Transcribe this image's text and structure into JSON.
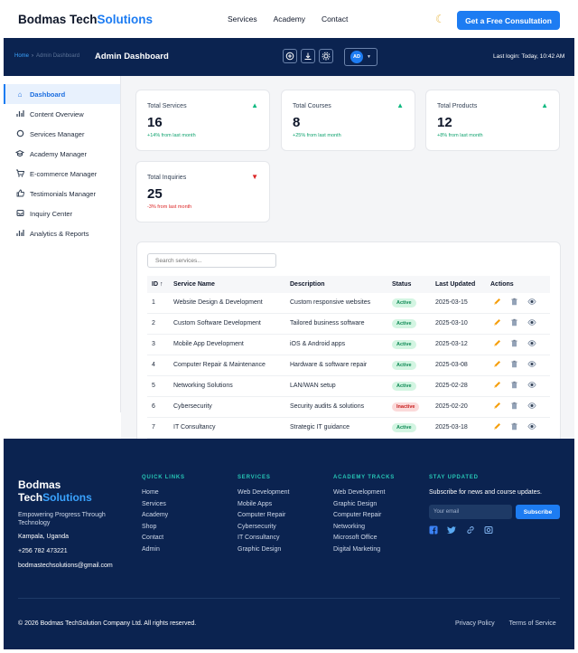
{
  "brand": {
    "name_part1": "Bodmas Tech",
    "name_part2": "Solutions"
  },
  "topnav": {
    "links": [
      "Services",
      "Academy",
      "Contact"
    ],
    "theme_icon": "moon-icon",
    "cta_label": "Get a Free Consultation"
  },
  "adminbar": {
    "breadcrumb": {
      "home": "Home",
      "separator": "›",
      "current": "Admin Dashboard"
    },
    "title": "Admin Dashboard",
    "toolbar_icons": [
      "add-circle-icon",
      "download-icon",
      "gear-icon"
    ],
    "avatar_initials": "AD",
    "last_login": "Last login: Today, 10:42 AM"
  },
  "sidebar": {
    "items": [
      {
        "label": "Dashboard",
        "icon": "home-icon",
        "active": true
      },
      {
        "label": "Content Overview",
        "icon": "bar-chart-icon"
      },
      {
        "label": "Services Manager",
        "icon": "gear-icon"
      },
      {
        "label": "Academy Manager",
        "icon": "graduation-cap-icon"
      },
      {
        "label": "E-commerce Manager",
        "icon": "cart-icon"
      },
      {
        "label": "Testimonials Manager",
        "icon": "thumbs-up-icon"
      },
      {
        "label": "Inquiry Center",
        "icon": "inbox-icon"
      },
      {
        "label": "Analytics & Reports",
        "icon": "bar-chart-icon"
      }
    ]
  },
  "stats": [
    {
      "label": "Total Services",
      "value": "16",
      "change": "+14% from last month",
      "trend": "up"
    },
    {
      "label": "Total Courses",
      "value": "8",
      "change": "+25% from last month",
      "trend": "up"
    },
    {
      "label": "Total Products",
      "value": "12",
      "change": "+8% from last month",
      "trend": "up"
    },
    {
      "label": "Total Inquiries",
      "value": "25",
      "change": "-3% from last month",
      "trend": "down"
    }
  ],
  "services_table": {
    "search_placeholder": "Search services...",
    "columns": [
      "ID ↑",
      "Service Name",
      "Description",
      "Status",
      "Last Updated",
      "Actions"
    ],
    "rows": [
      {
        "id": "1",
        "name": "Website Design & Development",
        "description": "Custom responsive websites",
        "status": "Active",
        "updated": "2025-03-15"
      },
      {
        "id": "2",
        "name": "Custom Software Development",
        "description": "Tailored business software",
        "status": "Active",
        "updated": "2025-03-10"
      },
      {
        "id": "3",
        "name": "Mobile App Development",
        "description": "iOS & Android apps",
        "status": "Active",
        "updated": "2025-03-12"
      },
      {
        "id": "4",
        "name": "Computer Repair & Maintenance",
        "description": "Hardware & software repair",
        "status": "Active",
        "updated": "2025-03-08"
      },
      {
        "id": "5",
        "name": "Networking Solutions",
        "description": "LAN/WAN setup",
        "status": "Active",
        "updated": "2025-02-28"
      },
      {
        "id": "6",
        "name": "Cybersecurity",
        "description": "Security audits & solutions",
        "status": "Inactive",
        "updated": "2025-02-20"
      },
      {
        "id": "7",
        "name": "IT Consultancy",
        "description": "Strategic IT guidance",
        "status": "Active",
        "updated": "2025-03-18"
      }
    ],
    "row_actions": [
      "edit-icon",
      "delete-icon",
      "view-icon"
    ]
  },
  "footer": {
    "brand_line1": "Bodmas",
    "brand_line2a": "Tech",
    "brand_line2b": "Solutions",
    "tagline": "Empowering Progress Through Technology",
    "location": "Kampala, Uganda",
    "phone": "+256 782 473221",
    "email": "bodmastechsolutions@gmail.com",
    "columns": [
      {
        "heading": "QUICK LINKS",
        "items": [
          "Home",
          "Services",
          "Academy",
          "Shop",
          "Contact",
          "Admin"
        ]
      },
      {
        "heading": "SERVICES",
        "items": [
          "Web Development",
          "Mobile Apps",
          "Computer Repair",
          "Cybersecurity",
          "IT Consultancy",
          "Graphic Design"
        ]
      },
      {
        "heading": "ACADEMY TRACKS",
        "items": [
          "Web Development",
          "Graphic Design",
          "Computer Repair",
          "Networking",
          "Microsoft Office",
          "Digital Marketing"
        ]
      }
    ],
    "newsletter": {
      "heading": "STAY UPDATED",
      "text": "Subscribe for news and course updates.",
      "placeholder": "Your email",
      "button": "Subscribe"
    },
    "social_icons": [
      "facebook-icon",
      "twitter-icon",
      "link-icon",
      "instagram-icon"
    ],
    "copyright": "© 2026 Bodmas TechSolution Company Ltd. All rights reserved.",
    "legal_links": [
      "Privacy Policy",
      "Terms of Service"
    ]
  },
  "colors": {
    "accent": "#1d7cf2",
    "navy": "#0b2350",
    "teal": "#26c6b5",
    "success": "#10a36f",
    "danger": "#dc2626"
  }
}
